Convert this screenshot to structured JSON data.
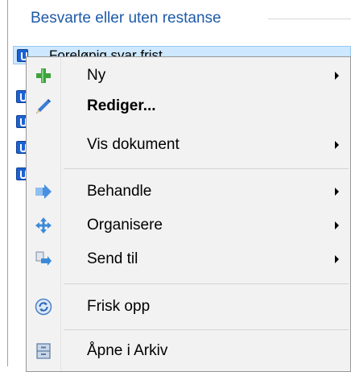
{
  "list": {
    "group_title": "Besvarte eller uten restanse",
    "selected_row_text": "Foreløpig svar frist"
  },
  "menu": {
    "items": [
      {
        "label": "Ny",
        "icon": "plus-icon",
        "submenu": true,
        "bold": false
      },
      {
        "label": "Rediger...",
        "icon": "pencil-icon",
        "submenu": false,
        "bold": true
      },
      {
        "label": "Vis dokument",
        "icon": "",
        "submenu": true,
        "bold": false
      },
      {
        "label": "Behandle",
        "icon": "forward-arrows-icon",
        "submenu": true,
        "bold": false
      },
      {
        "label": "Organisere",
        "icon": "move-icon",
        "submenu": true,
        "bold": false
      },
      {
        "label": "Send til",
        "icon": "send-to-icon",
        "submenu": true,
        "bold": false
      },
      {
        "label": "Frisk opp",
        "icon": "refresh-icon",
        "submenu": false,
        "bold": false
      },
      {
        "label": "Åpne i Arkiv",
        "icon": "archive-icon",
        "submenu": false,
        "bold": false
      }
    ]
  },
  "colors": {
    "group_title": "#1e5aa8",
    "selection": "#cde8ff",
    "menu_background": "#f2f2f2"
  }
}
